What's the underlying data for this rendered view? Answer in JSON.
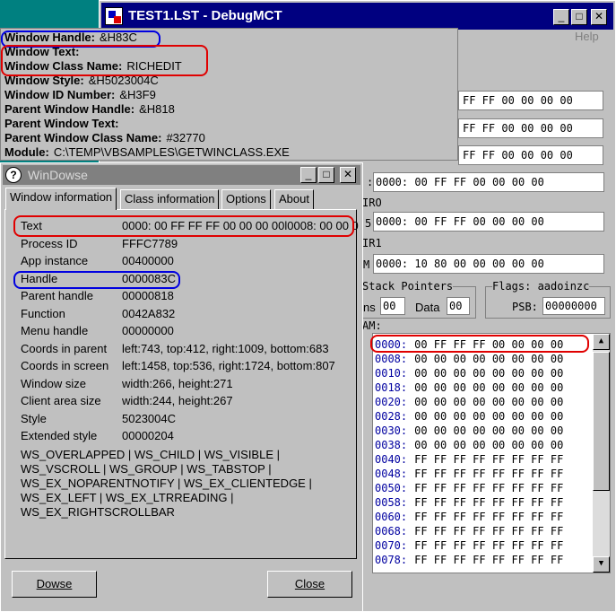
{
  "debugmct": {
    "title": "TEST1.LST - DebugMCT",
    "help": "Help",
    "top_hex": [
      "FF FF 00 00 00 00",
      "FF FF 00 00 00 00",
      "FF FF 00 00 00 00"
    ],
    "row1_prefix": ":",
    "row1_hex": "0000: 00 FF FF 00 00 00 00",
    "iro_label": "IRO",
    "row2_prefix": "5",
    "row2_hex": "0000: 00 FF FF 00 00 00 00",
    "ir1_label": "IR1",
    "row3_prefix": "M",
    "row3_hex": "0000: 10 80 00 00 00 00 00",
    "stack_label": "Stack Pointers",
    "ns_label": "ns",
    "ns_value": "00",
    "data_label": "Data",
    "data_value": "00",
    "flags_label": "Flags: aadoinzc",
    "psb_label": "PSB:",
    "psb_value": "00000000",
    "am_label": "AM:",
    "ram_rows": [
      {
        "addr": "0000:",
        "hex": "00 FF FF FF 00 00 00 00"
      },
      {
        "addr": "0008:",
        "hex": "00 00 00 00 00 00 00 00"
      },
      {
        "addr": "0010:",
        "hex": "00 00 00 00 00 00 00 00"
      },
      {
        "addr": "0018:",
        "hex": "00 00 00 00 00 00 00 00"
      },
      {
        "addr": "0020:",
        "hex": "00 00 00 00 00 00 00 00"
      },
      {
        "addr": "0028:",
        "hex": "00 00 00 00 00 00 00 00"
      },
      {
        "addr": "0030:",
        "hex": "00 00 00 00 00 00 00 00"
      },
      {
        "addr": "0038:",
        "hex": "00 00 00 00 00 00 00 00"
      },
      {
        "addr": "0040:",
        "hex": "FF FF FF FF FF FF FF FF"
      },
      {
        "addr": "0048:",
        "hex": "FF FF FF FF FF FF FF FF"
      },
      {
        "addr": "0050:",
        "hex": "FF FF FF FF FF FF FF FF"
      },
      {
        "addr": "0058:",
        "hex": "FF FF FF FF FF FF FF FF"
      },
      {
        "addr": "0060:",
        "hex": "FF FF FF FF FF FF FF FF"
      },
      {
        "addr": "0068:",
        "hex": "FF FF FF FF FF FF FF FF"
      },
      {
        "addr": "0070:",
        "hex": "FF FF FF FF FF FF FF FF"
      },
      {
        "addr": "0078:",
        "hex": "FF FF FF FF FF FF FF FF"
      }
    ]
  },
  "info": {
    "rows": [
      {
        "label": "Window Handle:",
        "value": "&H83C"
      },
      {
        "label": "Window Text:",
        "value": ""
      },
      {
        "label": "Window Class Name:",
        "value": "RICHEDIT"
      },
      {
        "label": "Window Style:",
        "value": "&H5023004C"
      },
      {
        "label": "Window ID Number:",
        "value": "&H3F9"
      },
      {
        "label": "Parent Window Handle:",
        "value": "&H818"
      },
      {
        "label": "Parent Window Text:",
        "value": ""
      },
      {
        "label": "Parent Window Class Name:",
        "value": "#32770"
      },
      {
        "label": "Module:",
        "value": "C:\\TEMP\\VBSAMPLES\\GETWINCLASS.EXE"
      }
    ]
  },
  "windowse": {
    "title": "WinDowse",
    "tabs": [
      "Window information",
      "Class information",
      "Options",
      "About"
    ],
    "fields": [
      {
        "label": "Text",
        "value": "0000: 00 FF FF FF 00 00 00 00l0008: 00 00 0"
      },
      {
        "label": "Process ID",
        "value": "FFFC7789"
      },
      {
        "label": "App instance",
        "value": "00400000"
      },
      {
        "label": "Handle",
        "value": "0000083C"
      },
      {
        "label": "Parent handle",
        "value": "00000818"
      },
      {
        "label": "Function",
        "value": "0042A832"
      },
      {
        "label": "Menu handle",
        "value": "00000000"
      },
      {
        "label": "Coords in parent",
        "value": "left:743, top:412, right:1009, bottom:683"
      },
      {
        "label": "Coords in screen",
        "value": "left:1458, top:536, right:1724, bottom:807"
      },
      {
        "label": "Window size",
        "value": "width:266, height:271"
      },
      {
        "label": "Client area size",
        "value": "width:244, height:267"
      },
      {
        "label": "Style",
        "value": "5023004C"
      },
      {
        "label": "Extended style",
        "value": "00000204"
      }
    ],
    "style_lines": [
      "WS_OVERLAPPED | WS_CHILD | WS_VISIBLE |",
      "WS_VSCROLL | WS_GROUP | WS_TABSTOP |",
      "WS_EX_NOPARENTNOTIFY | WS_EX_CLIENTEDGE |",
      "WS_EX_LEFT | WS_EX_LTRREADING |",
      "WS_EX_RIGHTSCROLLBAR"
    ],
    "dowse_label": "Dowse",
    "close_label": "Close"
  },
  "colors": {
    "annotation_red": "#e00000",
    "annotation_blue": "#0000e0",
    "title_active": "#000080",
    "address_blue": "#0000a0"
  }
}
